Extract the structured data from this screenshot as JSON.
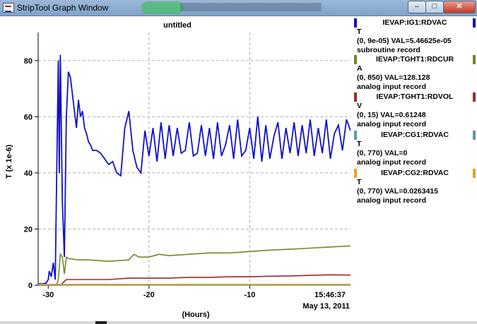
{
  "window": {
    "title": "StripTool Graph Window",
    "controls": {
      "minimize": "–",
      "maximize": "□",
      "close": "✕"
    }
  },
  "plot": {
    "title": "untitled",
    "ylabel": "T (x 1e-6)",
    "xlabel": "(Hours)",
    "y_ticks": [
      "80",
      "60",
      "40",
      "20",
      "0"
    ],
    "x_ticks": [
      "-30",
      "-20",
      "-10"
    ],
    "time": "15:46:37",
    "date": "May 13, 2011"
  },
  "legend": [
    {
      "name": "IEVAP:IG1:RDVAC",
      "units": "T",
      "range_value": "(0, 9e-05) VAL=5.46625e-05",
      "record": "subroutine record",
      "color": "#1010c8"
    },
    {
      "name": "IEVAP:TGHT1:RDCUR",
      "units": "A",
      "range_value": "(0, 850) VAL=128.128",
      "record": "analog input record",
      "color": "#6e8a2a"
    },
    {
      "name": "IEVAP:TGHT1:RDVOL",
      "units": "V",
      "range_value": "(0, 15) VAL=0.61248",
      "record": "analog input record",
      "color": "#a02828"
    },
    {
      "name": "IEVAP:CG1:RDVAC",
      "units": "T",
      "range_value": "(0, 770) VAL=0",
      "record": "analog input record",
      "color": "#5a9aa6"
    },
    {
      "name": "IEVAP:CG2:RDVAC",
      "units": "T",
      "range_value": "(0, 770) VAL=0.0263415",
      "record": "analog input record",
      "color": "#f0a020"
    }
  ],
  "chart_data": {
    "type": "line",
    "ylabel": "T (x 1e-6)",
    "xlabel": "(Hours)",
    "xlim": [
      -31,
      0
    ],
    "ylim": [
      0,
      90
    ],
    "grid": true,
    "series": [
      {
        "name": "IEVAP:IG1:RDVAC",
        "color": "#1010c8",
        "x": [
          -31,
          -30.5,
          -30.2,
          -30.0,
          -29.9,
          -29.7,
          -29.5,
          -29.3,
          -29.2,
          -29.0,
          -28.9,
          -28.8,
          -28.6,
          -28.4,
          -28.2,
          -28.0,
          -27.8,
          -27.6,
          -27.4,
          -27.2,
          -27.0,
          -26.8,
          -26.6,
          -26.4,
          -26.2,
          -26.0,
          -25.8,
          -25.6,
          -25.2,
          -24.8,
          -24.4,
          -24.0,
          -23.6,
          -23.2,
          -22.8,
          -22.4,
          -22.0,
          -21.6,
          -21.2,
          -20.8,
          -20.4,
          -20.0,
          -19.6,
          -19.2,
          -18.8,
          -18.4,
          -18.0,
          -17.6,
          -17.2,
          -16.8,
          -16.4,
          -16.0,
          -15.6,
          -15.2,
          -14.8,
          -14.4,
          -14.0,
          -13.6,
          -13.2,
          -12.8,
          -12.4,
          -12.0,
          -11.6,
          -11.2,
          -10.8,
          -10.4,
          -10.0,
          -9.6,
          -9.2,
          -8.8,
          -8.4,
          -8.0,
          -7.6,
          -7.2,
          -6.8,
          -6.4,
          -6.0,
          -5.6,
          -5.2,
          -4.8,
          -4.4,
          -4.0,
          -3.6,
          -3.2,
          -2.8,
          -2.4,
          -2.0,
          -1.6,
          -1.2,
          -0.8,
          -0.4,
          0.0
        ],
        "y": [
          0.5,
          0.5,
          0.8,
          2.0,
          5.0,
          3.0,
          8.0,
          2.0,
          30.0,
          80.0,
          40.0,
          82.0,
          30.0,
          10.0,
          60.0,
          76.0,
          74.0,
          68.0,
          62.0,
          56.0,
          66.0,
          60.0,
          62.0,
          56.0,
          54.0,
          51.0,
          50.0,
          48.0,
          48.0,
          47.0,
          45.0,
          43.0,
          44.0,
          40.0,
          39.0,
          56.0,
          62.0,
          48.0,
          42.0,
          40.0,
          55.0,
          46.0,
          56.0,
          44.0,
          58.0,
          45.0,
          57.0,
          46.0,
          56.0,
          47.0,
          48.0,
          58.0,
          46.0,
          47.0,
          57.0,
          46.0,
          56.0,
          45.0,
          58.0,
          46.0,
          50.0,
          57.0,
          45.0,
          59.0,
          46.0,
          48.0,
          56.0,
          45.0,
          60.0,
          44.0,
          57.0,
          45.0,
          53.0,
          58.0,
          45.0,
          56.0,
          47.0,
          58.0,
          46.0,
          57.0,
          47.0,
          59.0,
          46.0,
          56.0,
          47.0,
          59.0,
          45.0,
          54.0,
          57.0,
          48.0,
          59.0,
          55.0
        ]
      },
      {
        "name": "IEVAP:TGHT1:RDCUR",
        "color": "#6e8a2a",
        "x": [
          -31,
          -29.5,
          -29.2,
          -29.0,
          -28.8,
          -28.6,
          -28.4,
          -28.2,
          -28.0,
          -27.0,
          -26.0,
          -24.0,
          -22.0,
          -21.5,
          -21.0,
          -20.0,
          -19.0,
          -18.0,
          -16.0,
          -14.0,
          -12.0,
          -10.0,
          -8.0,
          -6.0,
          -4.0,
          -2.0,
          0.0
        ],
        "y": [
          0,
          0,
          0,
          2.0,
          11.0,
          10.0,
          4.0,
          10.0,
          9.5,
          9.0,
          9.0,
          8.5,
          9.0,
          11.0,
          10.0,
          10.0,
          11.0,
          10.5,
          11.0,
          11.5,
          11.5,
          12.0,
          12.5,
          12.8,
          13.2,
          13.6,
          14.0
        ]
      },
      {
        "name": "IEVAP:TGHT1:RDVOL",
        "color": "#a02828",
        "x": [
          -31,
          -29.5,
          -29.0,
          -28.8,
          -28.5,
          -28.2,
          -28.0,
          -27.0,
          -26.0,
          -24.0,
          -22.0,
          -20.0,
          -18.0,
          -16.0,
          -14.0,
          -12.0,
          -10.0,
          -8.0,
          -6.0,
          -4.0,
          -2.0,
          0.0
        ],
        "y": [
          0,
          0,
          0,
          0,
          1.0,
          2.0,
          2.0,
          2.0,
          2.0,
          2.0,
          2.5,
          2.5,
          2.5,
          2.8,
          2.8,
          3.0,
          3.0,
          3.2,
          3.3,
          3.5,
          3.7,
          3.6
        ]
      },
      {
        "name": "IEVAP:CG1:RDVAC",
        "color": "#5a9aa6",
        "x": [
          -31,
          0
        ],
        "y": [
          0,
          0
        ]
      },
      {
        "name": "IEVAP:CG2:RDVAC",
        "color": "#f0a020",
        "x": [
          -31,
          0
        ],
        "y": [
          0.3,
          0.3
        ]
      }
    ]
  }
}
